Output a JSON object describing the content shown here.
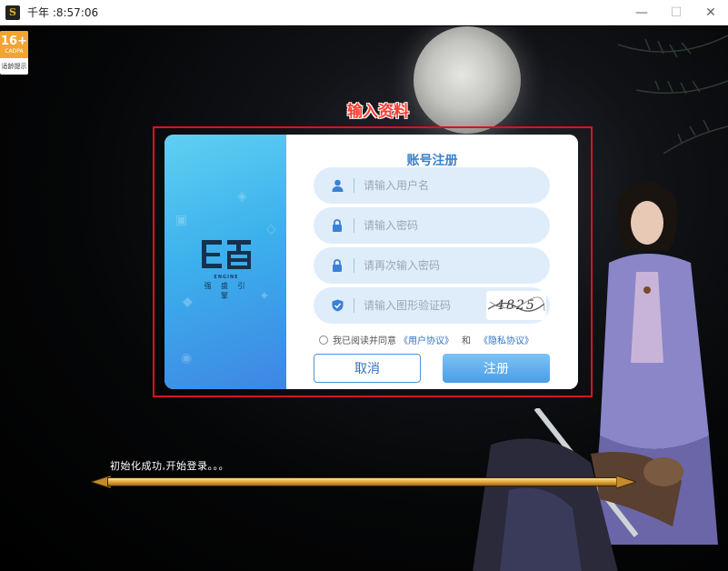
{
  "window": {
    "title": "千年 :8:57:06",
    "app_icon": "game-logo-icon",
    "app_icon_glyph": "S",
    "minimize": "—",
    "maximize": "☐",
    "close": "✕"
  },
  "age_rating": {
    "number": "16+",
    "org": "CADPA",
    "note": "适龄提示"
  },
  "section_title": "输入资料",
  "brand": {
    "engine": "ENGINE",
    "name": "强 盛 引 擎"
  },
  "form": {
    "title": "账号注册",
    "username": {
      "placeholder": "请输入用户名",
      "value": "",
      "icon": "user-icon"
    },
    "password": {
      "placeholder": "请输入密码",
      "value": "",
      "icon": "lock-icon"
    },
    "password_confirm": {
      "placeholder": "请再次输入密码",
      "value": "",
      "icon": "lock-icon"
    },
    "captcha": {
      "placeholder": "请输入图形验证码",
      "value": "",
      "icon": "shield-check-icon",
      "image_text": "4825"
    },
    "agreement": {
      "prefix": "我已阅读并同意",
      "user_agreement": "《用户协议》",
      "and": "和",
      "privacy_agreement": "《隐私协议》",
      "checked": false
    },
    "cancel_label": "取消",
    "register_label": "注册"
  },
  "status": {
    "message": "初始化成功,开始登录。。。",
    "progress": 1.0
  },
  "colors": {
    "accent": "#3a80d0",
    "highlight_frame": "#d8141b",
    "title_red": "#ff3b2f"
  }
}
